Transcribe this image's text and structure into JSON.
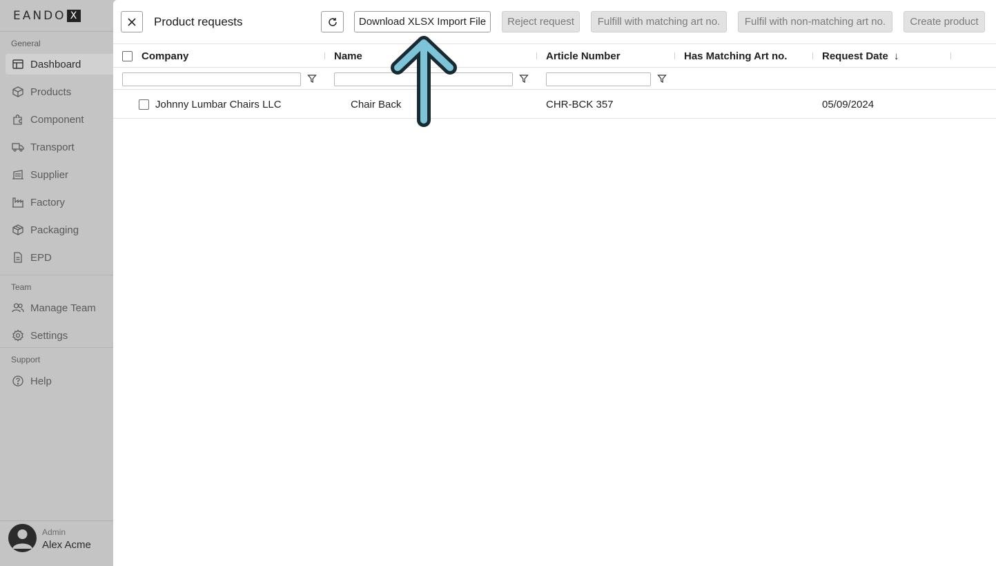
{
  "brand": {
    "logo_text": "EANDO",
    "logo_mark": "X"
  },
  "sidebar": {
    "sections": {
      "general": "General",
      "team": "Team",
      "support": "Support"
    },
    "items": [
      {
        "label": "Dashboard",
        "icon": "table-icon"
      },
      {
        "label": "Products",
        "icon": "cube-icon"
      },
      {
        "label": "Component",
        "icon": "puzzle-icon"
      },
      {
        "label": "Transport",
        "icon": "truck-icon"
      },
      {
        "label": "Supplier",
        "icon": "warehouse-icon"
      },
      {
        "label": "Factory",
        "icon": "factory-icon"
      },
      {
        "label": "Packaging",
        "icon": "package-icon"
      },
      {
        "label": "EPD",
        "icon": "document-icon"
      },
      {
        "label": "Manage Team",
        "icon": "users-icon"
      },
      {
        "label": "Settings",
        "icon": "gear-icon"
      },
      {
        "label": "Help",
        "icon": "help-icon"
      }
    ],
    "user": {
      "role": "Admin",
      "name": "Alex Acme"
    }
  },
  "header": {
    "title": "Product requests",
    "buttons": {
      "download": "Download XLSX Import File",
      "reject": "Reject request",
      "fulfill_matching": "Fulfill with matching art no.",
      "fulfil_non_matching": "Fulfil with non-matching art no.",
      "create": "Create product"
    }
  },
  "table": {
    "columns": [
      "Company",
      "Name",
      "Article Number",
      "Has Matching Art no.",
      "Request Date"
    ],
    "sort_indicator": "↓",
    "rows": [
      {
        "company": "Johnny Lumbar Chairs LLC",
        "name": "Chair Back",
        "article_number": "CHR-BCK 357",
        "has_matching": "",
        "request_date": "05/09/2024"
      }
    ]
  },
  "colors": {
    "sidebar_bg": "#c4c4c4",
    "arrow_fill": "#7ec4d8",
    "arrow_outline": "#1a2a33"
  }
}
